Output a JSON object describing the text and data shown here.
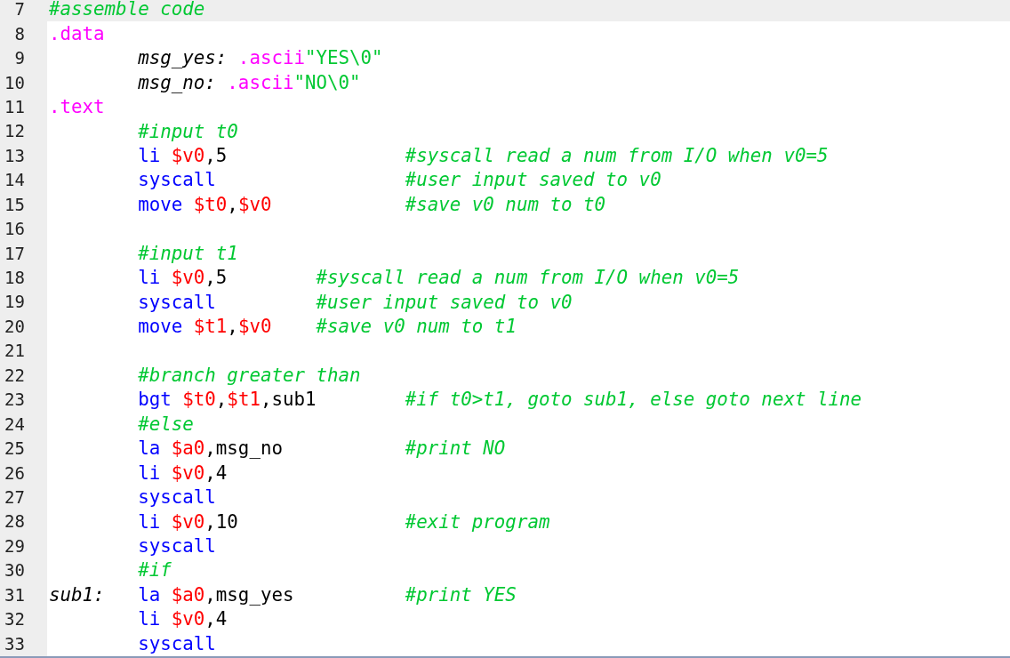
{
  "lines": [
    {
      "number": "7",
      "highlighted": true,
      "label": {
        "kind": "comment",
        "text": "#assemble code"
      }
    },
    {
      "number": "8",
      "highlighted": false,
      "label": {
        "kind": "directive",
        "text": ".data"
      }
    },
    {
      "number": "9",
      "highlighted": false,
      "tokens": [
        {
          "kind": "label",
          "text": "msg_yes:"
        },
        {
          "kind": "directive",
          "text": ".ascii"
        },
        {
          "kind": "string",
          "text": "\"YES\\0\""
        }
      ]
    },
    {
      "number": "10",
      "highlighted": false,
      "tokens": [
        {
          "kind": "label",
          "text": "msg_no:"
        },
        {
          "kind": "directive",
          "text": ".ascii"
        },
        {
          "kind": "string",
          "text": "\"NO\\0\""
        }
      ]
    },
    {
      "number": "11",
      "highlighted": false,
      "label": {
        "kind": "directive",
        "text": ".text"
      }
    },
    {
      "number": "12",
      "highlighted": false,
      "tokens": [
        {
          "kind": "comment",
          "text": "#input t0"
        }
      ]
    },
    {
      "number": "13",
      "highlighted": false,
      "tokens": [
        {
          "kind": "instruction",
          "text": "li"
        },
        {
          "kind": "register",
          "text": "$v0"
        },
        {
          "kind": "plain",
          "text": ",5"
        }
      ],
      "comment": "#syscall read a num from I/O when v0=5"
    },
    {
      "number": "14",
      "highlighted": false,
      "tokens": [
        {
          "kind": "instruction",
          "text": "syscall"
        }
      ],
      "comment": "#user input saved to v0"
    },
    {
      "number": "15",
      "highlighted": false,
      "tokens": [
        {
          "kind": "instruction",
          "text": "move"
        },
        {
          "kind": "register",
          "text": "$t0"
        },
        {
          "kind": "plain",
          "text": ","
        },
        {
          "kind": "register",
          "text": "$v0"
        }
      ],
      "comment": "#save v0 num to t0"
    },
    {
      "number": "16",
      "highlighted": false
    },
    {
      "number": "17",
      "highlighted": false,
      "tokens": [
        {
          "kind": "comment",
          "text": "#input t1"
        }
      ]
    },
    {
      "number": "18",
      "highlighted": false,
      "tokens": [
        {
          "kind": "instruction",
          "text": "li"
        },
        {
          "kind": "register",
          "text": "$v0"
        },
        {
          "kind": "plain",
          "text": ",5"
        }
      ],
      "comment": "#syscall read a num from I/O when v0=5"
    },
    {
      "number": "19",
      "highlighted": false,
      "tokens": [
        {
          "kind": "instruction",
          "text": "syscall"
        }
      ],
      "comment": "#user input saved to v0"
    },
    {
      "number": "20",
      "highlighted": false,
      "tokens": [
        {
          "kind": "instruction",
          "text": "move"
        },
        {
          "kind": "register",
          "text": "$t1"
        },
        {
          "kind": "plain",
          "text": ","
        },
        {
          "kind": "register",
          "text": "$v0"
        }
      ],
      "comment": "#save v0 num to t1"
    },
    {
      "number": "21",
      "highlighted": false
    },
    {
      "number": "22",
      "highlighted": false,
      "tokens": [
        {
          "kind": "comment",
          "text": "#branch greater than"
        }
      ]
    },
    {
      "number": "23",
      "highlighted": false,
      "tokens": [
        {
          "kind": "instruction",
          "text": "bgt"
        },
        {
          "kind": "register",
          "text": "$t0"
        },
        {
          "kind": "plain",
          "text": ","
        },
        {
          "kind": "register",
          "text": "$t1"
        },
        {
          "kind": "plain",
          "text": ",sub1"
        }
      ],
      "comment": "#if t0>t1, goto sub1, else goto next line"
    },
    {
      "number": "24",
      "highlighted": false,
      "tokens": [
        {
          "kind": "comment",
          "text": "#else"
        }
      ]
    },
    {
      "number": "25",
      "highlighted": false,
      "tokens": [
        {
          "kind": "instruction",
          "text": "la"
        },
        {
          "kind": "register",
          "text": "$a0"
        },
        {
          "kind": "plain",
          "text": ",msg_no"
        }
      ],
      "comment": "#print NO"
    },
    {
      "number": "26",
      "highlighted": false,
      "tokens": [
        {
          "kind": "instruction",
          "text": "li"
        },
        {
          "kind": "register",
          "text": "$v0"
        },
        {
          "kind": "plain",
          "text": ",4"
        }
      ]
    },
    {
      "number": "27",
      "highlighted": false,
      "tokens": [
        {
          "kind": "instruction",
          "text": "syscall"
        }
      ]
    },
    {
      "number": "28",
      "highlighted": false,
      "tokens": [
        {
          "kind": "instruction",
          "text": "li"
        },
        {
          "kind": "register",
          "text": "$v0"
        },
        {
          "kind": "plain",
          "text": ",10"
        }
      ],
      "comment": "#exit program"
    },
    {
      "number": "29",
      "highlighted": false,
      "tokens": [
        {
          "kind": "instruction",
          "text": "syscall"
        }
      ]
    },
    {
      "number": "30",
      "highlighted": false,
      "tokens": [
        {
          "kind": "comment",
          "text": "#if"
        }
      ]
    },
    {
      "number": "31",
      "highlighted": false,
      "label": {
        "kind": "label",
        "text": "sub1:"
      },
      "tokens": [
        {
          "kind": "instruction",
          "text": "la"
        },
        {
          "kind": "register",
          "text": "$a0"
        },
        {
          "kind": "plain",
          "text": ",msg_yes"
        }
      ],
      "comment": "#print YES"
    },
    {
      "number": "32",
      "highlighted": false,
      "tokens": [
        {
          "kind": "instruction",
          "text": "li"
        },
        {
          "kind": "register",
          "text": "$v0"
        },
        {
          "kind": "plain",
          "text": ",4"
        }
      ]
    },
    {
      "number": "33",
      "highlighted": false,
      "tokens": [
        {
          "kind": "instruction",
          "text": "syscall"
        }
      ]
    }
  ]
}
